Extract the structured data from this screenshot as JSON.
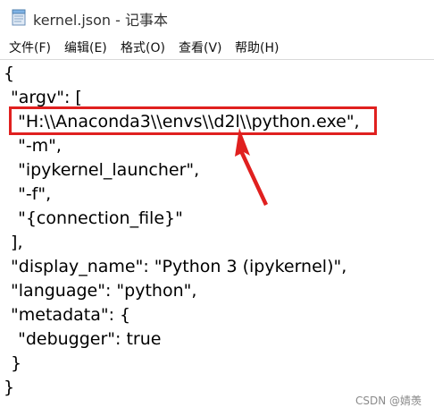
{
  "window": {
    "title": "kernel.json - 记事本",
    "icon": "notepad-icon"
  },
  "menu": [
    "文件(F)",
    "编辑(E)",
    "格式(O)",
    "查看(V)",
    "帮助(H)"
  ],
  "content": {
    "lines": [
      "{",
      " \"argv\": [",
      "  \"H:\\\\Anaconda3\\\\envs\\\\d2l\\\\python.exe\",",
      "  \"-m\",",
      "  \"ipykernel_launcher\",",
      "  \"-f\",",
      "  \"{connection_file}\"",
      " ],",
      " \"display_name\": \"Python 3 (ipykernel)\",",
      " \"language\": \"python\",",
      " \"metadata\": {",
      "  \"debugger\": true",
      " }",
      "}"
    ]
  },
  "annotation": {
    "color": "#e0201f",
    "highlighted_line": 2,
    "arrow": "red-arrow-icon"
  },
  "watermark": "CSDN @婧羡"
}
